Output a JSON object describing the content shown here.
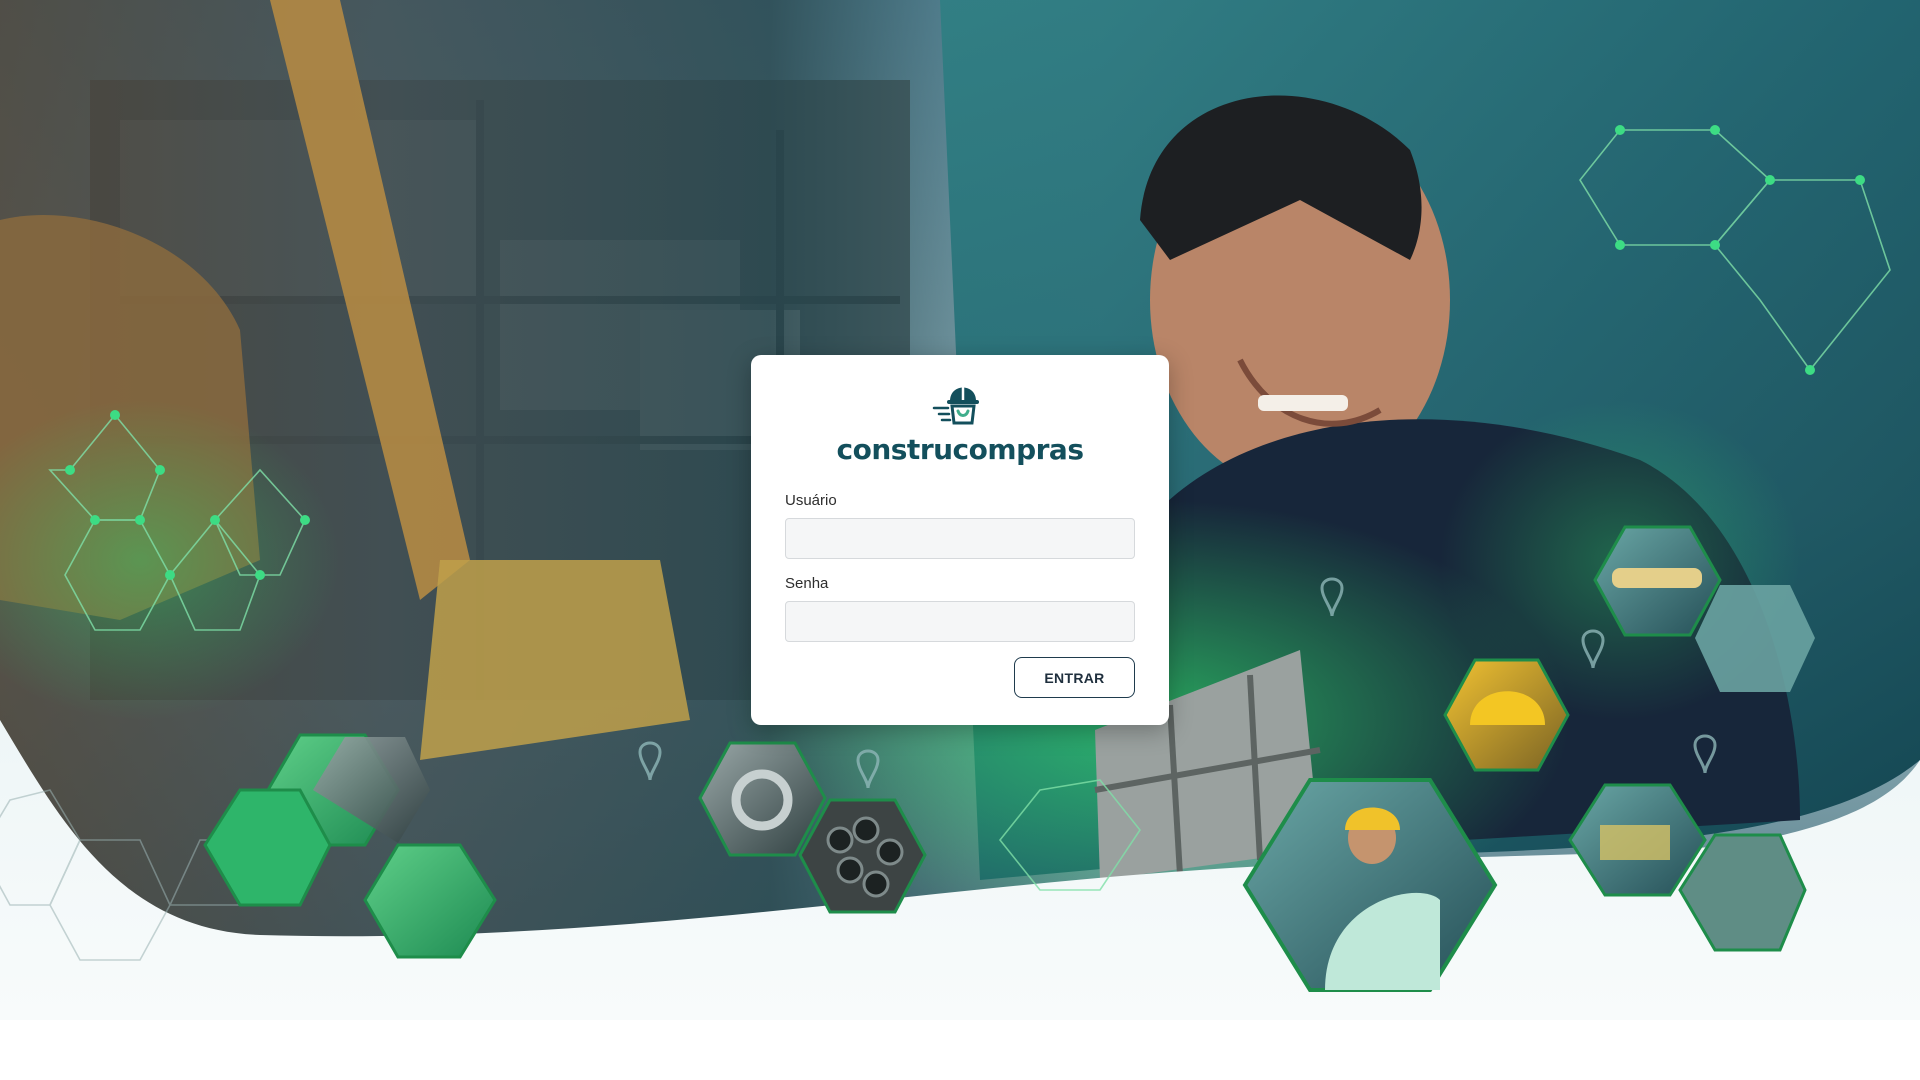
{
  "brand": {
    "name": "construcompras",
    "logo_icon": "delivery-helmet-icon",
    "color": "#134f5c"
  },
  "login": {
    "username_label": "Usuário",
    "username_value": "",
    "password_label": "Senha",
    "password_value": "",
    "submit_label": "ENTRAR"
  },
  "theme": {
    "accent_teal": "#0f6e72",
    "accent_green": "#1fa34a",
    "button_border": "#1f3b4d"
  }
}
